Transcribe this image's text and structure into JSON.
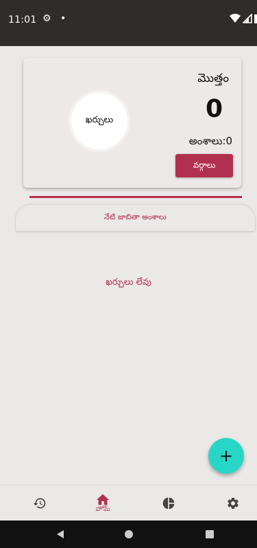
{
  "status_bar": {
    "time": "11:01",
    "gear_glyph": "⚙",
    "dot_glyph": "•"
  },
  "summary": {
    "circle_label": "ఖర్చులు",
    "total_label": "మొత్తం",
    "total_value": "0",
    "items_count": "అంశాలు:0",
    "categories_button": "వర్గాలు"
  },
  "list": {
    "tab_label": "నేటి జాబితా అంశాలు",
    "empty_message": "ఖర్చులు లేవు"
  },
  "fab": {
    "label": "+"
  },
  "bottom_nav": {
    "home_label": "హోమ్"
  },
  "colors": {
    "accent": "#b2304f",
    "fab": "#28d6c8",
    "background": "#ebe9e8",
    "status_bar": "#2f2c2b"
  },
  "icons": {
    "history": "history-icon",
    "home": "home-icon",
    "chart": "pie-chart-icon",
    "settings": "gear-icon"
  }
}
